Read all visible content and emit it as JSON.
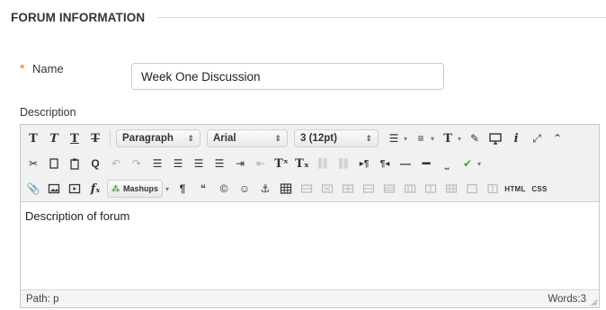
{
  "section": {
    "title": "FORUM INFORMATION"
  },
  "name_field": {
    "required_marker": "*",
    "label": "Name",
    "value": "Week One Discussion"
  },
  "description": {
    "label": "Description",
    "content": "Description of forum",
    "path_label": "Path:",
    "path_value": "p",
    "words_label": "Words:",
    "words_value": "3"
  },
  "toolbar": {
    "row1": {
      "format_select": "Paragraph",
      "font_select": "Arial",
      "size_select": "3 (12pt)"
    },
    "row3": {
      "mashups_label": "Mashups",
      "html_label": "HTML",
      "css_label": "CSS"
    }
  },
  "colors": {
    "accent": "#e8731e",
    "border": "#c8c8c8",
    "toolbar_bg": "#f1f1f1"
  }
}
